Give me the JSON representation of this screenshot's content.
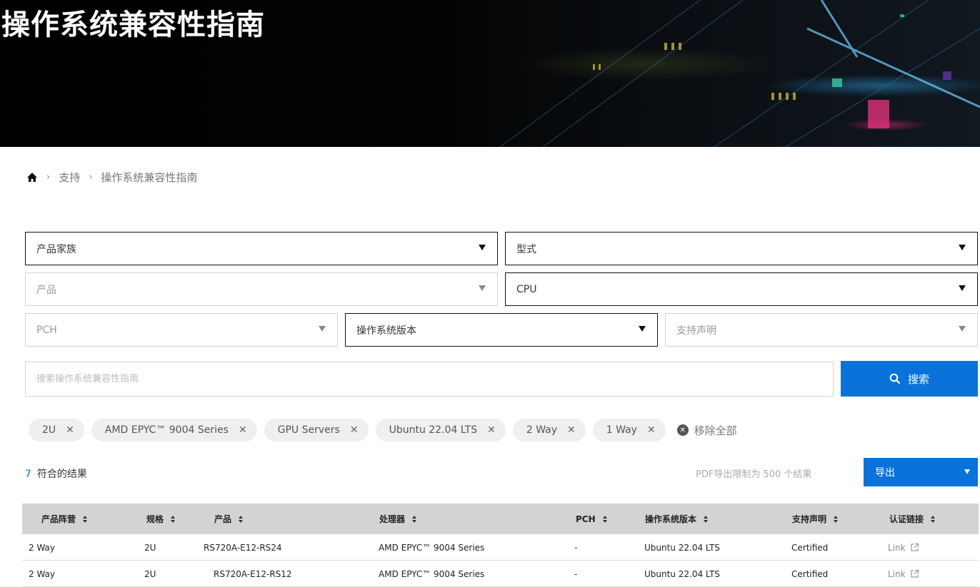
{
  "hero": {
    "title": "操作系统兼容性指南"
  },
  "breadcrumb": {
    "items": [
      "支持",
      "操作系统兼容性指南"
    ]
  },
  "filters": {
    "product_family": "产品家族",
    "model": "型式",
    "product": "产品",
    "cpu": "CPU",
    "pch": "PCH",
    "os_version": "操作系统版本",
    "support_statement": "支持声明"
  },
  "search": {
    "placeholder": "搜索操作系统兼容性指南",
    "button_label": "搜索"
  },
  "chips": [
    "2U",
    "AMD EPYC™ 9004 Series",
    "GPU Servers",
    "Ubuntu 22.04 LTS",
    "2 Way",
    "1 Way"
  ],
  "clear_all": "移除全部",
  "results": {
    "count": "7",
    "label": "符合的结果",
    "pdf_note": "PDF导出限制为 500 个结果",
    "export_label": "导出"
  },
  "table": {
    "headers": [
      "产品阵营",
      "规格",
      "产品",
      "处理器",
      "PCH",
      "操作系统版本",
      "支持声明",
      "认证链接"
    ],
    "rows": [
      [
        "2 Way",
        "2U",
        "RS720A-E12-RS24",
        "AMD EPYC™ 9004 Series",
        "-",
        "Ubuntu 22.04 LTS",
        "Certified",
        "Link"
      ],
      [
        "2 Way",
        "2U",
        "RS720A-E12-RS12",
        "AMD EPYC™ 9004 Series",
        "-",
        "Ubuntu 22.04 LTS",
        "Certified",
        "Link"
      ]
    ]
  },
  "colors": {
    "accent": "#0a73d9",
    "header_bg": "#d3d3d3"
  }
}
